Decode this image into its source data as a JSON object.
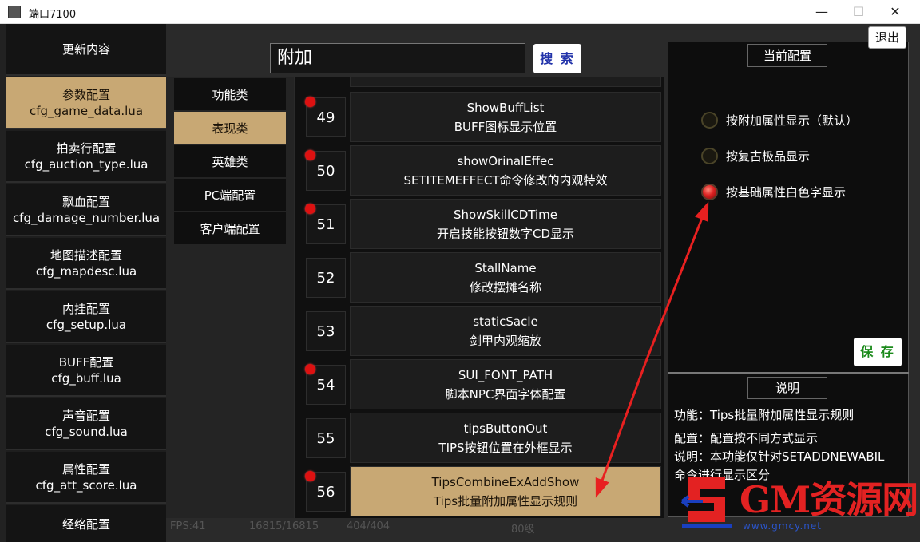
{
  "window": {
    "title": "端口7100",
    "min": "—",
    "max": "☐",
    "close": "✕"
  },
  "exit_label": "退出",
  "left_menu": [
    {
      "line1": "更新内容",
      "line2": ""
    },
    {
      "line1": "参数配置",
      "line2": "cfg_game_data.lua"
    },
    {
      "line1": "拍卖行配置",
      "line2": "cfg_auction_type.lua"
    },
    {
      "line1": "飘血配置",
      "line2": "cfg_damage_number.lua"
    },
    {
      "line1": "地图描述配置",
      "line2": "cfg_mapdesc.lua"
    },
    {
      "line1": "内挂配置",
      "line2": "cfg_setup.lua"
    },
    {
      "line1": "BUFF配置",
      "line2": "cfg_buff.lua"
    },
    {
      "line1": "声音配置",
      "line2": "cfg_sound.lua"
    },
    {
      "line1": "属性配置",
      "line2": "cfg_att_score.lua"
    },
    {
      "line1": "经络配置",
      "line2": ""
    }
  ],
  "categories": [
    "功能类",
    "表现类",
    "英雄类",
    "PC端配置",
    "客户端配置"
  ],
  "search": {
    "value": "附加",
    "button": "搜 索"
  },
  "rows": [
    {
      "num": "49",
      "name": "ShowBuffList",
      "desc": "BUFF图标显示位置"
    },
    {
      "num": "50",
      "name": "showOrinalEffec",
      "desc": "SETITEMEFFECT命令修改的内观特效"
    },
    {
      "num": "51",
      "name": "ShowSkillCDTime",
      "desc": "开启技能按钮数字CD显示"
    },
    {
      "num": "52",
      "name": "StallName",
      "desc": "修改摆摊名称"
    },
    {
      "num": "53",
      "name": "staticSacle",
      "desc": "剑甲内观缩放"
    },
    {
      "num": "54",
      "name": "SUI_FONT_PATH",
      "desc": "脚本NPC界面字体配置"
    },
    {
      "num": "55",
      "name": "tipsButtonOut",
      "desc": "TIPS按钮位置在外框显示"
    },
    {
      "num": "56",
      "name": "TipsCombineExAddShow",
      "desc": "Tips批量附加属性显示规则"
    }
  ],
  "current_config": {
    "title": "当前配置",
    "options": [
      "按附加属性显示（默认）",
      "按复古极品显示",
      "按基础属性白色字显示"
    ],
    "selected_index": 2,
    "save_label": "保 存"
  },
  "description": {
    "title": "说明",
    "lines": [
      "功能：Tips批量附加属性显示规则",
      "配置：配置按不同方式显示",
      "说明：本功能仅针对SETADDNEWABIL",
      "命令进行显示区分"
    ]
  },
  "status": {
    "fps": "FPS:41",
    "counts": "16815/16815",
    "ratio": "404/404",
    "level": "80级"
  },
  "watermark": {
    "text": "GM资源网",
    "url": "www.gmcy.net"
  },
  "colors": {
    "accent": "#c8a874",
    "radio_active": "#d22222",
    "arrow": "#e82020",
    "watermark": "#e32222"
  }
}
